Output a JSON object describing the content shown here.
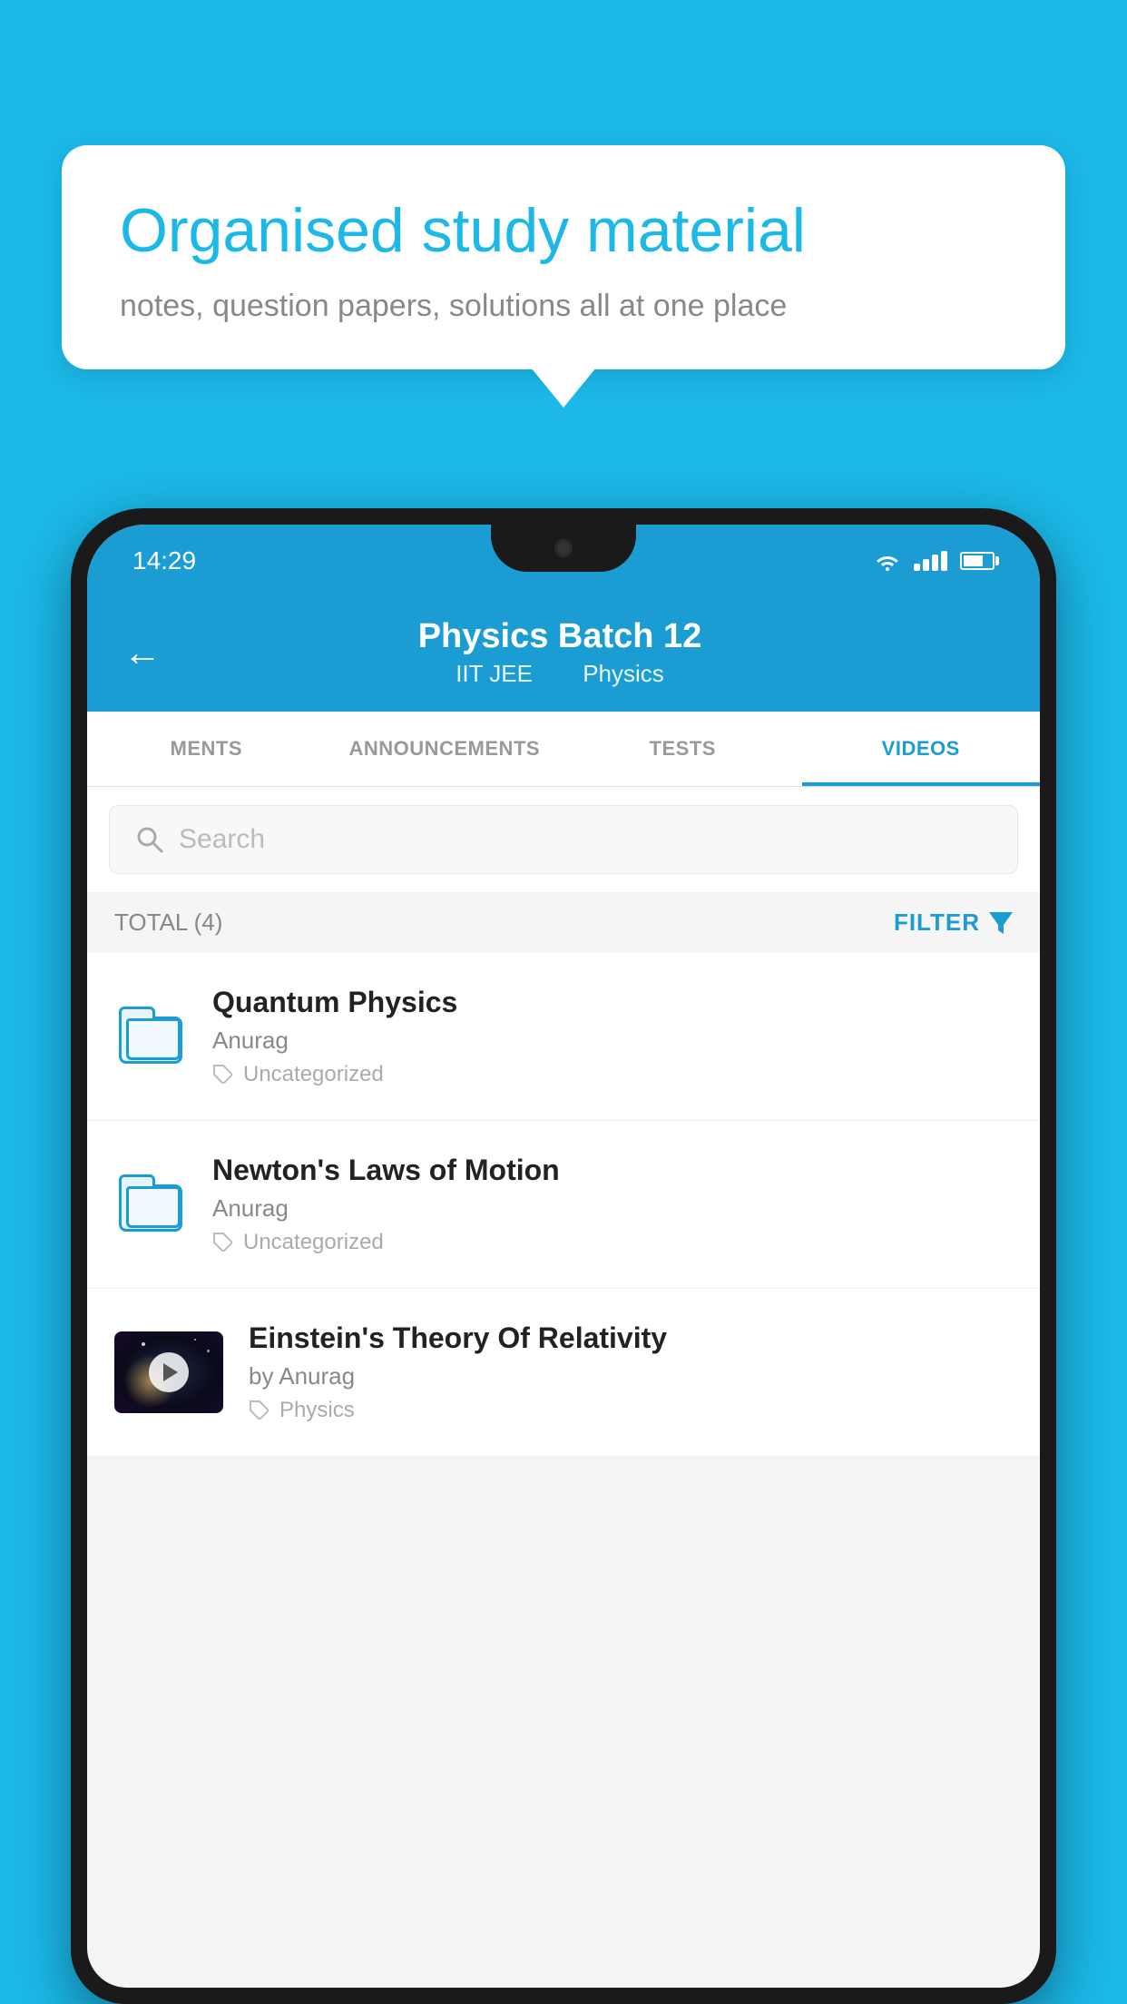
{
  "background": {
    "color": "#1bb8e8"
  },
  "speech_bubble": {
    "title": "Organised study material",
    "subtitle": "notes, question papers, solutions all at one place"
  },
  "phone": {
    "status_bar": {
      "time": "14:29"
    },
    "header": {
      "title": "Physics Batch 12",
      "subtitle_part1": "IIT JEE",
      "subtitle_part2": "Physics",
      "back_label": "←"
    },
    "tabs": [
      {
        "label": "MENTS",
        "active": false
      },
      {
        "label": "ANNOUNCEMENTS",
        "active": false
      },
      {
        "label": "TESTS",
        "active": false
      },
      {
        "label": "VIDEOS",
        "active": true
      }
    ],
    "search": {
      "placeholder": "Search"
    },
    "filter_bar": {
      "total_label": "TOTAL (4)",
      "filter_label": "FILTER"
    },
    "videos": [
      {
        "id": 1,
        "title": "Quantum Physics",
        "author": "Anurag",
        "tag": "Uncategorized",
        "has_thumbnail": false
      },
      {
        "id": 2,
        "title": "Newton's Laws of Motion",
        "author": "Anurag",
        "tag": "Uncategorized",
        "has_thumbnail": false
      },
      {
        "id": 3,
        "title": "Einstein's Theory Of Relativity",
        "author": "by Anurag",
        "tag": "Physics",
        "has_thumbnail": true
      }
    ]
  }
}
